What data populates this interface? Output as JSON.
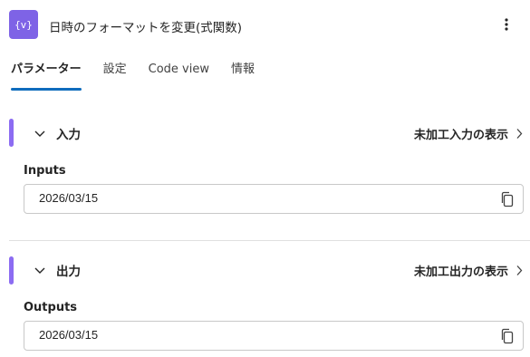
{
  "header": {
    "icon": "variable-braces-icon",
    "title": "日時のフォーマットを変更(式関数)",
    "more_icon": "more-vertical-icon",
    "accent_color": "#7e63e6"
  },
  "tabs": [
    {
      "label": "パラメーター",
      "active": true
    },
    {
      "label": "設定",
      "active": false
    },
    {
      "label": "Code view",
      "active": false
    },
    {
      "label": "情報",
      "active": false
    }
  ],
  "sections": [
    {
      "title": "入力",
      "raw_link": "未加工入力の表示",
      "field_label": "Inputs",
      "field_value": "2026/03/15"
    },
    {
      "title": "出力",
      "raw_link": "未加工出力の表示",
      "field_label": "Outputs",
      "field_value": "2026/03/15"
    }
  ],
  "colors": {
    "section_bar": "#8c6cf2",
    "tab_underline": "#0f6cbd"
  }
}
